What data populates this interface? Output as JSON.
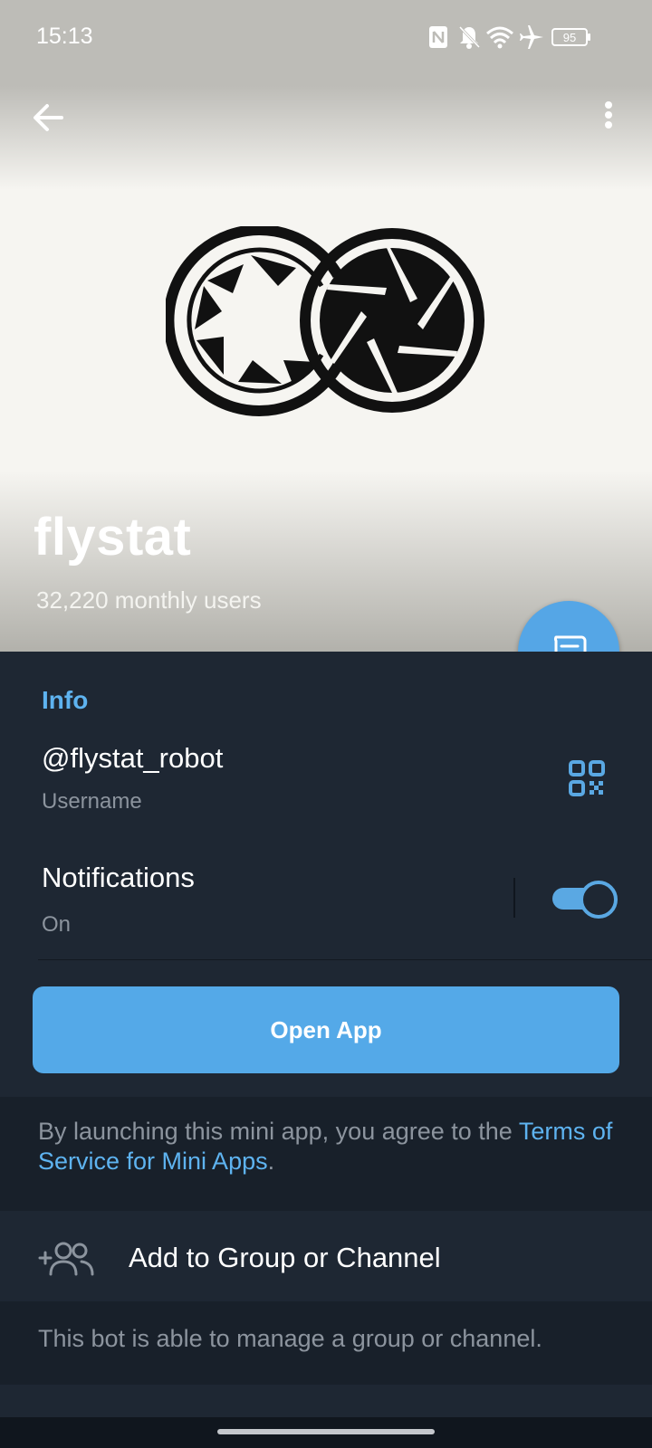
{
  "status_bar": {
    "time": "15:13",
    "battery_level": "95",
    "icons": [
      "nfc-icon",
      "silent-bell-icon",
      "wifi-icon",
      "airplane-icon",
      "battery-icon"
    ]
  },
  "header": {
    "bot_name": "flystat",
    "monthly_users": "32,220 monthly users",
    "background_colors": [
      "#bdbcb7",
      "#f6f5f1",
      "#b2b1ab"
    ]
  },
  "info": {
    "heading": "Info",
    "username": "@flystat_robot",
    "username_label": "Username",
    "notifications_title": "Notifications",
    "notifications_status": "On",
    "notifications_enabled": true
  },
  "open_app": {
    "label": "Open App"
  },
  "terms": {
    "prefix": "By launching this mini app, you agree to the ",
    "link": "Terms of Service for Mini Apps",
    "suffix": "."
  },
  "add_group": {
    "label": "Add to Group or Channel",
    "note": "This bot is able to manage a group or channel."
  },
  "bottom_peek": {
    "label": ""
  },
  "colors": {
    "accent": "#54a9e8",
    "link": "#5eb3f0",
    "background": "#1e2733",
    "section_gap": "#18202a",
    "secondary_text": "#8c949e"
  }
}
